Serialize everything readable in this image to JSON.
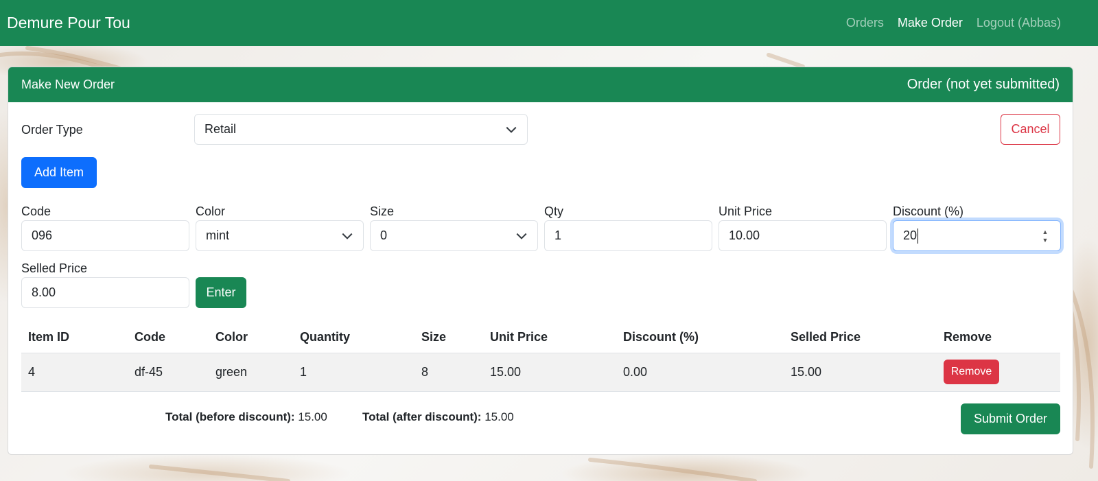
{
  "navbar": {
    "brand": "Demure Pour Tou",
    "links": [
      {
        "label": "Orders"
      },
      {
        "label": "Make Order"
      },
      {
        "label": "Logout (Abbas)"
      }
    ]
  },
  "card": {
    "title": "Make New Order",
    "status": "Order (not yet submitted)"
  },
  "order_type": {
    "label": "Order Type",
    "value": "Retail"
  },
  "buttons": {
    "cancel": "Cancel",
    "add_item": "Add Item",
    "enter": "Enter",
    "submit": "Submit Order"
  },
  "item_form": {
    "code": {
      "label": "Code",
      "value": "096"
    },
    "color": {
      "label": "Color",
      "value": "mint"
    },
    "size": {
      "label": "Size",
      "value": "0"
    },
    "qty": {
      "label": "Qty",
      "value": "1"
    },
    "unit_price": {
      "label": "Unit Price",
      "value": "10.00"
    },
    "discount": {
      "label": "Discount (%)",
      "value": "20"
    },
    "selled_price": {
      "label": "Selled Price",
      "value": "8.00"
    }
  },
  "table": {
    "headers": [
      "Item ID",
      "Code",
      "Color",
      "Quantity",
      "Size",
      "Unit Price",
      "Discount (%)",
      "Selled Price",
      "Remove"
    ],
    "rows": [
      {
        "item_id": "4",
        "code": "df-45",
        "color": "green",
        "quantity": "1",
        "size": "8",
        "unit_price": "15.00",
        "discount": "0.00",
        "selled_price": "15.00",
        "remove": "Remove"
      }
    ]
  },
  "totals": {
    "before_label": "Total (before discount):",
    "before_value": "15.00",
    "after_label": "Total (after discount):",
    "after_value": "15.00"
  },
  "colors": {
    "brand_green": "#198754",
    "primary_blue": "#0d6efd",
    "danger_red": "#dc3545"
  }
}
